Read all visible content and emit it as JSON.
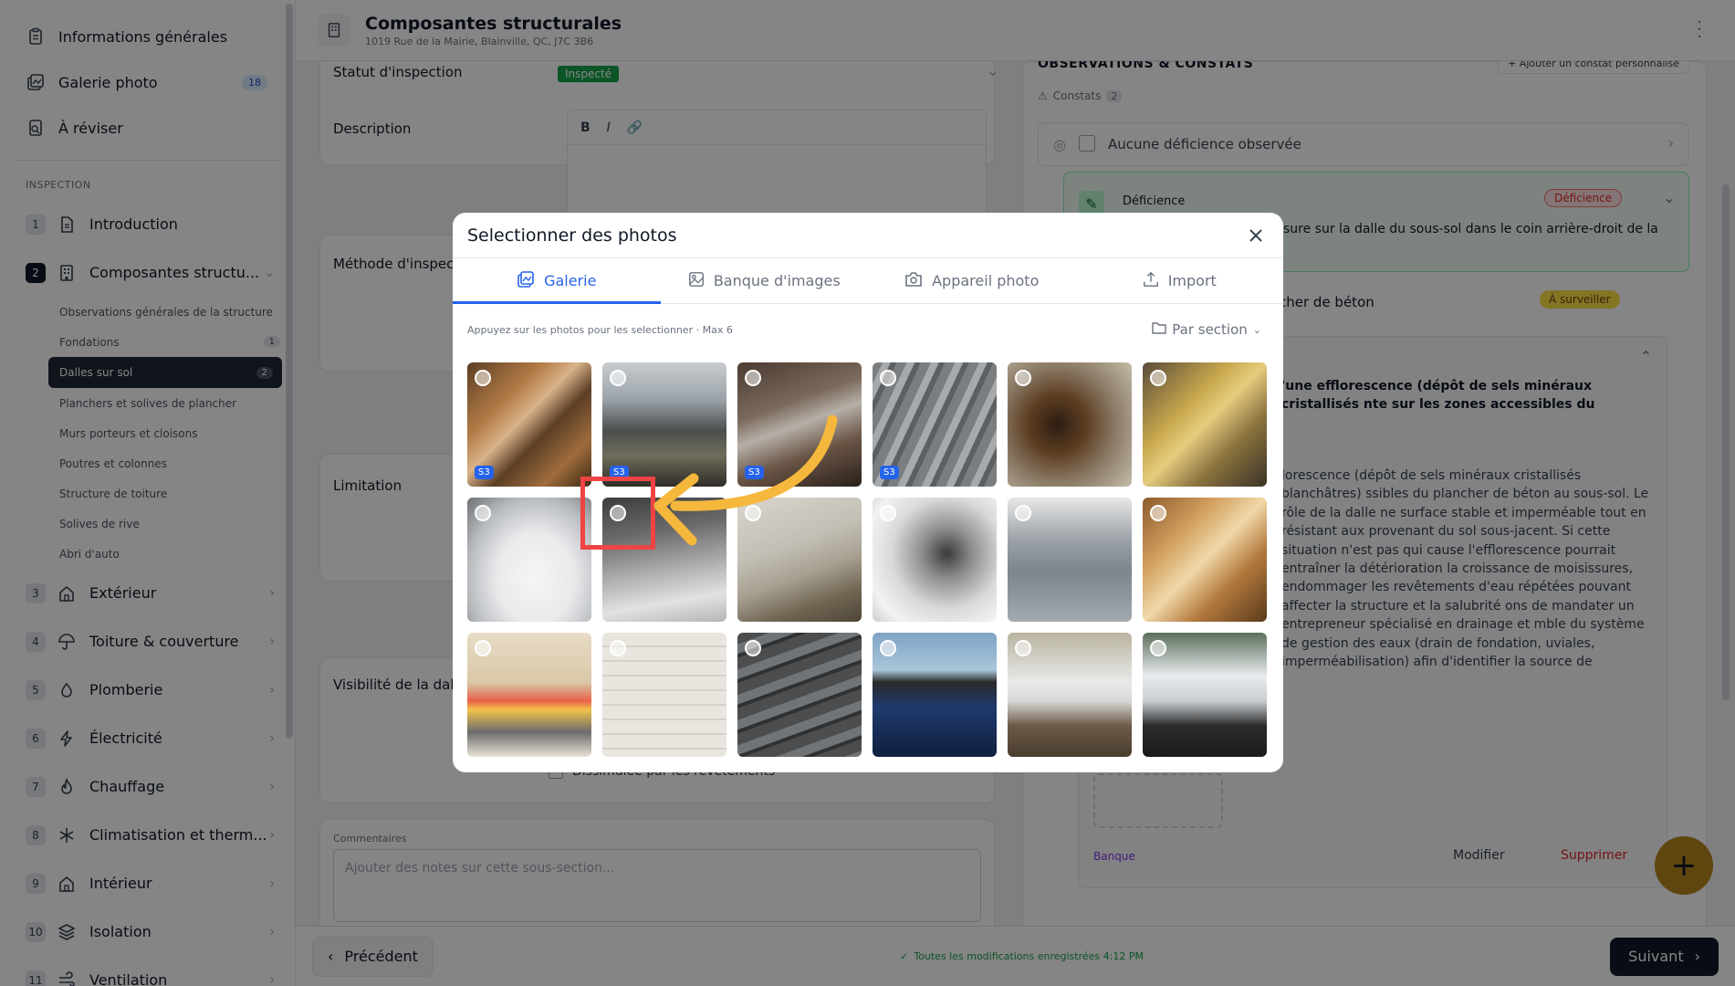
{
  "sidebar": {
    "top_items": [
      {
        "label": "Informations générales",
        "icon": "clipboard-icon",
        "badge": ""
      },
      {
        "label": "Galerie photo",
        "icon": "gallery-icon",
        "badge": "18"
      },
      {
        "label": "À réviser",
        "icon": "review-icon",
        "badge": ""
      }
    ],
    "section_label": "INSPECTION",
    "sections": [
      {
        "num": "1",
        "label": "Introduction",
        "icon": "document-icon"
      },
      {
        "num": "2",
        "label": "Composantes structu...",
        "icon": "building-icon"
      },
      {
        "num": "3",
        "label": "Extérieur",
        "icon": "home-icon"
      },
      {
        "num": "4",
        "label": "Toiture & couverture",
        "icon": "umbrella-icon"
      },
      {
        "num": "5",
        "label": "Plomberie",
        "icon": "faucet-icon"
      },
      {
        "num": "6",
        "label": "Électricité",
        "icon": "bolt-icon"
      },
      {
        "num": "7",
        "label": "Chauffage",
        "icon": "flame-icon"
      },
      {
        "num": "8",
        "label": "Climatisation et therm...",
        "icon": "snowflake-icon"
      },
      {
        "num": "9",
        "label": "Intérieur",
        "icon": "home-icon"
      },
      {
        "num": "10",
        "label": "Isolation",
        "icon": "layers-icon"
      },
      {
        "num": "11",
        "label": "Ventilation",
        "icon": "wind-icon"
      }
    ],
    "subitems": [
      {
        "label": "Observations générales de la structure",
        "count": ""
      },
      {
        "label": "Fondations",
        "count": "1"
      },
      {
        "label": "Dalles sur sol",
        "count": "2"
      },
      {
        "label": "Planchers et solives de plancher",
        "count": ""
      },
      {
        "label": "Murs porteurs et cloisons",
        "count": ""
      },
      {
        "label": "Poutres et colonnes",
        "count": ""
      },
      {
        "label": "Structure de toiture",
        "count": ""
      },
      {
        "label": "Solives de rive",
        "count": ""
      },
      {
        "label": "Abri d'auto",
        "count": ""
      }
    ]
  },
  "header": {
    "title": "Composantes structurales",
    "address": "1019 Rue de la Mairie, Blainville, QC, J7C 3B6"
  },
  "main": {
    "status_label": "Statut d'inspection",
    "status_value": "Inspecté",
    "description_label": "Description",
    "method_label": "Méthode d'inspect",
    "limitation_label": "Limitation",
    "visibility_label": "Visibilité de la dalle",
    "concealed_label": "Dissimulée par les revêtements",
    "comments_label": "Commentaires",
    "comments_placeholder": "Ajouter des notes sur cette sous-section...",
    "rte_buttons": [
      "B",
      "I",
      "🔗"
    ]
  },
  "observations": {
    "title": "OBSERVATIONS & CONSTATS",
    "add_button": "+ Ajouter un constat personnalisé",
    "constats_label": "Constats",
    "constats_count": "2",
    "no_deficiency": "Aucune déficience observée",
    "deficiency_label": "Déficience",
    "deficiency_pill": "Déficience",
    "deficiency_text": "sure sur la dalle du sous-sol dans le coin arrière-droit de la",
    "item2_text": "cher de béton",
    "watch_pill": "À surveiller",
    "item2_title": "'une efflorescence (dépôt de sels minéraux cristallisés nte sur les zones accessibles du plancher de béton au sous-",
    "item2_body": "lorescence (dépôt de sels minéraux cristallisés blanchâtres) ssibles du plancher de béton au sous-sol. Le rôle de la dalle ne surface stable et imperméable tout en résistant aux provenant du sol sous-jacent. Si cette situation n'est pas qui cause l'efflorescence pourrait entraîner la détérioration la croissance de moisissures, endommager les revêtements d'eau répétées pouvant affecter la structure et la salubrité ons de mandater un entrepreneur spécialisé en drainage et mble du système de gestion des eaux (drain de fondation, uviales, imperméabilisation) afin d'identifier la source de correctifs nécessaires ainsi que leur coût.",
    "bank_link": "Banque",
    "modify_label": "Modifier",
    "delete_label": "Supprimer"
  },
  "footer": {
    "prev_label": "Précédent",
    "saved_text": "Toutes les modifications enregistrées 4:12 PM",
    "next_label": "Suivant"
  },
  "modal": {
    "title": "Selectionner des photos",
    "tabs": [
      {
        "label": "Galerie",
        "icon": "gallery-icon",
        "active": true
      },
      {
        "label": "Banque d'images",
        "icon": "image-icon",
        "active": false
      },
      {
        "label": "Appareil photo",
        "icon": "camera-icon",
        "active": false
      },
      {
        "label": "Import",
        "icon": "upload-icon",
        "active": false
      }
    ],
    "hint": "Appuyez sur les photos pour les selectionner · Max 6",
    "group_by": "Par section",
    "photos": [
      {
        "badge": "S3",
        "desc": "wooden beams"
      },
      {
        "badge": "S3",
        "desc": "crawlspace duct"
      },
      {
        "badge": "S3",
        "desc": "pipes"
      },
      {
        "badge": "S3",
        "desc": "roof shingles ridge"
      },
      {
        "badge": "",
        "desc": "rotten wood"
      },
      {
        "badge": "",
        "desc": "insulation"
      },
      {
        "badge": "",
        "desc": "sink faucet"
      },
      {
        "badge": "",
        "desc": "basement floor"
      },
      {
        "badge": "",
        "desc": "cracked wall"
      },
      {
        "badge": "",
        "desc": "shower valve"
      },
      {
        "badge": "",
        "desc": "metal siding"
      },
      {
        "badge": "",
        "desc": "attic framing"
      },
      {
        "badge": "",
        "desc": "thermal camera"
      },
      {
        "badge": "",
        "desc": "garage door"
      },
      {
        "badge": "",
        "desc": "damaged shingles"
      },
      {
        "badge": "",
        "desc": "window frame"
      },
      {
        "badge": "",
        "desc": "downspout"
      },
      {
        "badge": "",
        "desc": "window sill"
      }
    ]
  },
  "colors": {
    "accent": "#2563eb",
    "highlight": "#ef4444",
    "arrow": "#f5b83d",
    "fab": "#b7871b"
  }
}
